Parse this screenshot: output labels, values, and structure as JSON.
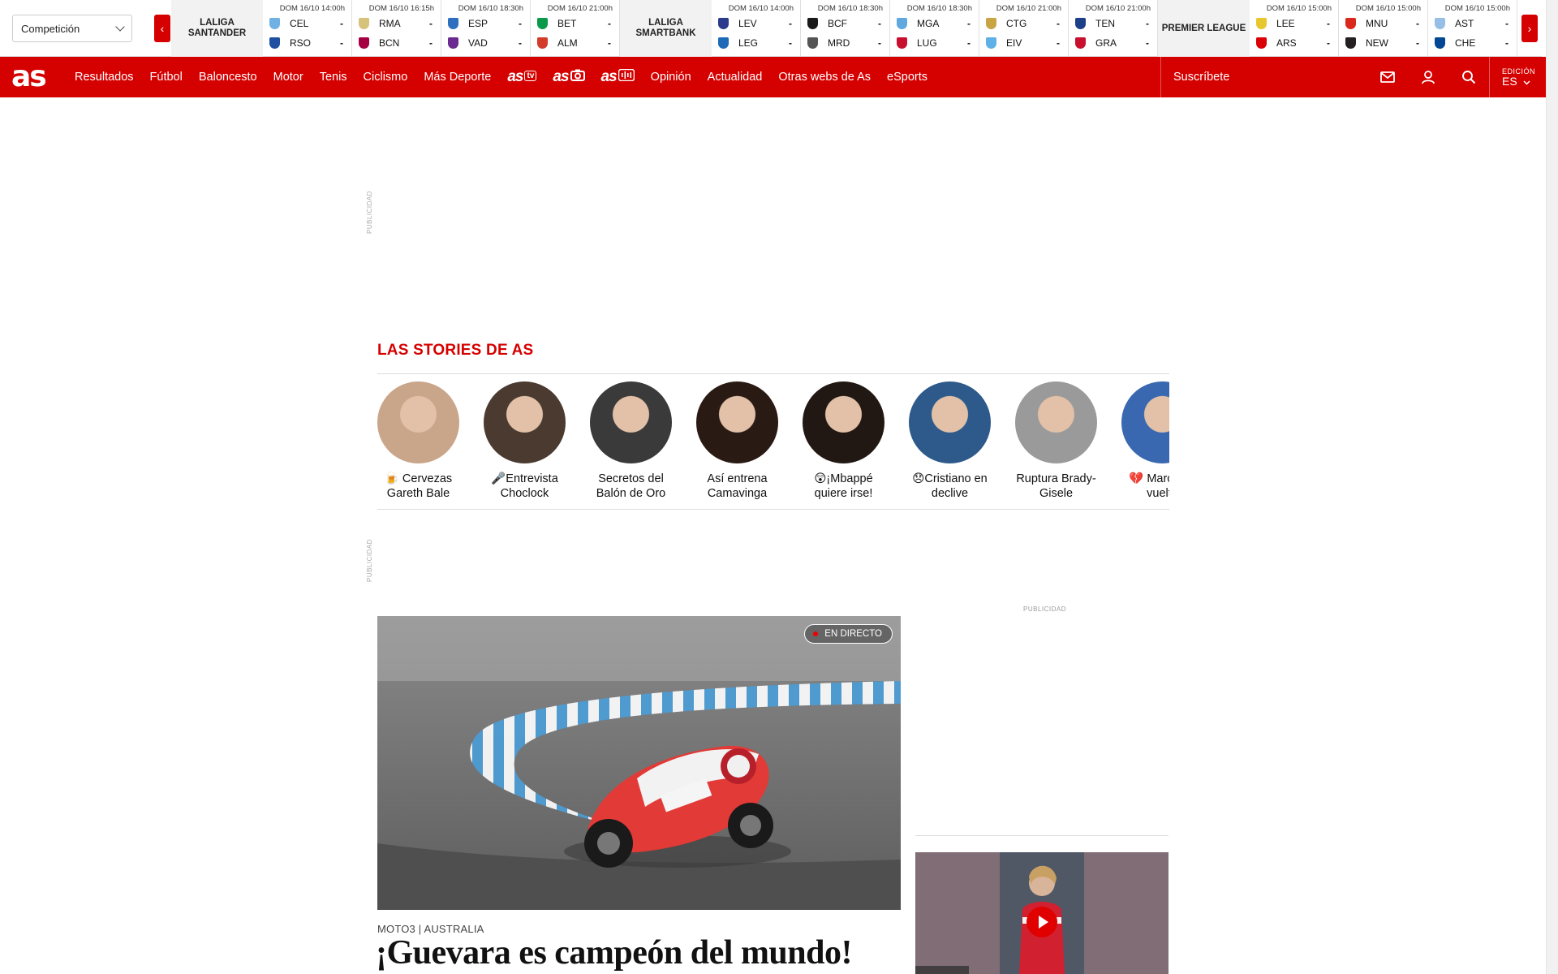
{
  "scores": {
    "competition_select": "Competición",
    "prev_label": "‹",
    "next_label": "›",
    "blocks": [
      {
        "league": "LALIGA SANTANDER",
        "matches": [
          {
            "when": "DOM 16/10 14:00h",
            "home": "CEL",
            "away": "RSO",
            "hs": "-",
            "as": "-",
            "hc": "#6fb1e3",
            "ac": "#1f4fa0"
          },
          {
            "when": "DOM 16/10 16:15h",
            "home": "RMA",
            "away": "BCN",
            "hs": "-",
            "as": "-",
            "hc": "#d6c27a",
            "ac": "#a50044"
          },
          {
            "when": "DOM 16/10 18:30h",
            "home": "ESP",
            "away": "VAD",
            "hs": "-",
            "as": "-",
            "hc": "#2f6fc0",
            "ac": "#6b2a8f"
          },
          {
            "when": "DOM 16/10 21:00h",
            "home": "BET",
            "away": "ALM",
            "hs": "-",
            "as": "-",
            "hc": "#0a9a4a",
            "ac": "#d23c2a"
          }
        ]
      },
      {
        "league": "LALIGA SMARTBANK",
        "matches": [
          {
            "when": "DOM 16/10 14:00h",
            "home": "LEV",
            "away": "LEG",
            "hs": "-",
            "as": "-",
            "hc": "#2a3a8c",
            "ac": "#1d6ab8"
          },
          {
            "when": "DOM 16/10 18:30h",
            "home": "BCF",
            "away": "MRD",
            "hs": "-",
            "as": "-",
            "hc": "#1a1a1a",
            "ac": "#555555"
          },
          {
            "when": "DOM 16/10 18:30h",
            "home": "MGA",
            "away": "LUG",
            "hs": "-",
            "as": "-",
            "hc": "#5fa8e0",
            "ac": "#c8102e"
          },
          {
            "when": "DOM 16/10 21:00h",
            "home": "CTG",
            "away": "EIV",
            "hs": "-",
            "as": "-",
            "hc": "#c8a445",
            "ac": "#5fb0e6"
          },
          {
            "when": "DOM 16/10 21:00h",
            "home": "TEN",
            "away": "GRA",
            "hs": "-",
            "as": "-",
            "hc": "#1d3f8a",
            "ac": "#c8102e"
          }
        ]
      },
      {
        "league": "PREMIER LEAGUE",
        "matches": [
          {
            "when": "DOM 16/10 15:00h",
            "home": "LEE",
            "away": "ARS",
            "hs": "-",
            "as": "-",
            "hc": "#e8c62e",
            "ac": "#db0007"
          },
          {
            "when": "DOM 16/10 15:00h",
            "home": "MNU",
            "away": "NEW",
            "hs": "-",
            "as": "-",
            "hc": "#da291c",
            "ac": "#241f20"
          },
          {
            "when": "DOM 16/10 15:00h",
            "home": "AST",
            "away": "CHE",
            "hs": "-",
            "as": "-",
            "hc": "#95bfe5",
            "ac": "#034694"
          }
        ]
      }
    ]
  },
  "nav": {
    "logo": "as",
    "items": [
      "Resultados",
      "Fútbol",
      "Baloncesto",
      "Motor",
      "Tenis",
      "Ciclismo",
      "Más Deporte"
    ],
    "brands": [
      "as",
      "as",
      "as"
    ],
    "items2": [
      "Opinión",
      "Actualidad",
      "Otras webs de As",
      "eSports"
    ],
    "subscribe": "Suscríbete",
    "edition_label": "EDICIÓN",
    "edition_code": "ES",
    "accent": "#d50000"
  },
  "ads": {
    "label": "PUBLICIDAD"
  },
  "stories": {
    "title": "LAS STORIES DE AS",
    "items": [
      {
        "caption": "🍺 Cervezas Gareth Bale",
        "bg": "#c9a58a"
      },
      {
        "caption": "🎤Entrevista Choclock",
        "bg": "#4a3a30"
      },
      {
        "caption": "Secretos del Balón de Oro",
        "bg": "#3a3a3a"
      },
      {
        "caption": "Así entrena Camavinga",
        "bg": "#2a1a14"
      },
      {
        "caption": "😲¡Mbappé quiere irse!",
        "bg": "#221813"
      },
      {
        "caption": "😞Cristiano en declive",
        "bg": "#2d5a8a"
      },
      {
        "caption": "Ruptura Brady-Gisele",
        "bg": "#9a9a9a"
      },
      {
        "caption": "💔 Marco ha vuelto",
        "bg": "#3a68b0"
      }
    ]
  },
  "main": {
    "live": "EN DIRECTO",
    "kicker": "MOTO3 | AUSTRALIA",
    "headline": "¡Guevara es campeón del mundo!"
  }
}
